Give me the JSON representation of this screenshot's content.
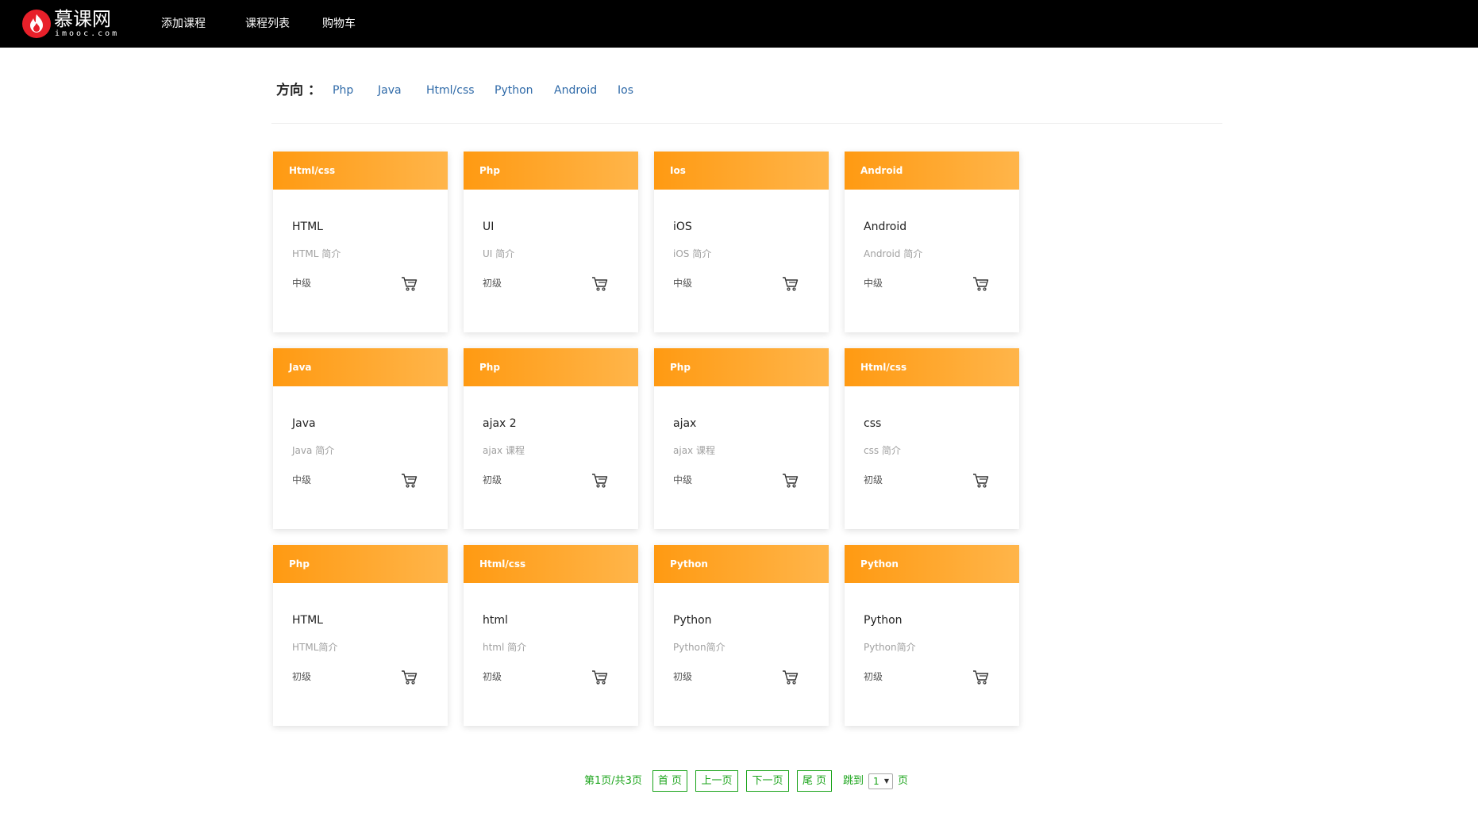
{
  "header": {
    "logo_text": "慕课网",
    "logo_sub": "imooc.com",
    "nav": [
      "添加课程",
      "课程列表",
      "购物车"
    ]
  },
  "filter": {
    "label": "方向 ：",
    "items": [
      "Php",
      "Java",
      "Html/css",
      "Python",
      "Android",
      "Ios"
    ]
  },
  "courses": [
    {
      "tag": "Html/css",
      "title": "HTML",
      "desc": "HTML 简介",
      "level": "中级"
    },
    {
      "tag": "Php",
      "title": "UI",
      "desc": "UI 简介",
      "level": "初级"
    },
    {
      "tag": "Ios",
      "title": "iOS",
      "desc": "iOS 简介",
      "level": "中级"
    },
    {
      "tag": "Android",
      "title": "Android",
      "desc": "Android 简介",
      "level": "中级"
    },
    {
      "tag": "Java",
      "title": "Java",
      "desc": "Java 简介",
      "level": "中级"
    },
    {
      "tag": "Php",
      "title": "ajax 2",
      "desc": "ajax 课程",
      "level": "初级"
    },
    {
      "tag": "Php",
      "title": "ajax",
      "desc": "ajax 课程",
      "level": "中级"
    },
    {
      "tag": "Html/css",
      "title": "css",
      "desc": "css 简介",
      "level": "初级"
    },
    {
      "tag": "Php",
      "title": "HTML",
      "desc": "HTML简介",
      "level": "初级"
    },
    {
      "tag": "Html/css",
      "title": "html",
      "desc": "html 简介",
      "level": "初级"
    },
    {
      "tag": "Python",
      "title": "Python",
      "desc": "Python简介",
      "level": "初级"
    },
    {
      "tag": "Python",
      "title": "Python",
      "desc": "Python简介",
      "level": "初级"
    }
  ],
  "pagination": {
    "info": "第1页/共3页",
    "first": "首 页",
    "prev": "上一页",
    "next": "下一页",
    "last": "尾 页",
    "jump": "跳到",
    "current": "1",
    "page_suffix": "页"
  },
  "colors": {
    "header_bg": "#000000",
    "card_accent": "#ff9a12",
    "link": "#2f6aa8",
    "pager": "#19a319"
  }
}
